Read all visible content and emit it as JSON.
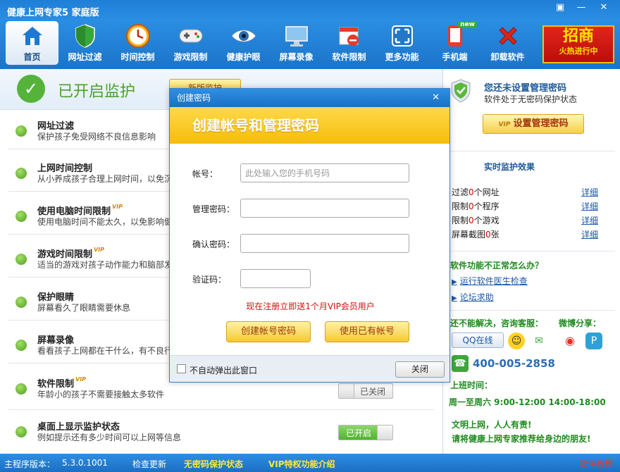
{
  "app": {
    "title": "健康上网专家5 家庭版",
    "window_buttons": [
      "▣",
      "—",
      "✕"
    ]
  },
  "toolbar": {
    "items": [
      {
        "label": "首页",
        "icon": "home-icon",
        "active": true
      },
      {
        "label": "网址过滤",
        "icon": "shield-icon"
      },
      {
        "label": "时间控制",
        "icon": "clock-icon"
      },
      {
        "label": "游戏限制",
        "icon": "gamepad-icon"
      },
      {
        "label": "健康护眼",
        "icon": "eye-icon"
      },
      {
        "label": "屏幕录像",
        "icon": "monitor-icon"
      },
      {
        "label": "软件限制",
        "icon": "software-block-icon"
      },
      {
        "label": "更多功能",
        "icon": "expand-icon"
      },
      {
        "label": "手机端",
        "icon": "phone-icon",
        "badge": "new"
      },
      {
        "label": "卸载软件",
        "icon": "uninstall-icon"
      }
    ],
    "promo": {
      "big": "招商",
      "small": "火热进行中"
    }
  },
  "status": {
    "text": "已开启监护",
    "renew_label": "新版监护"
  },
  "features": [
    {
      "title": "网址过滤",
      "vip": false,
      "desc": "保护孩子免受网络不良信息影响"
    },
    {
      "title": "上网时间控制",
      "vip": false,
      "desc": "从小养成孩子合理上网时间，以免沉"
    },
    {
      "title": "使用电脑时间限制",
      "vip": true,
      "desc": "使用电脑时间不能太久，以免影响健"
    },
    {
      "title": "游戏时间限制",
      "vip": true,
      "desc": "适当的游戏对孩子动作能力和脑部发"
    },
    {
      "title": "保护眼睛",
      "vip": false,
      "desc": "屏幕看久了眼睛需要休息"
    },
    {
      "title": "屏幕录像",
      "vip": false,
      "desc": "看看孩子上网都在干什么，有不良行"
    },
    {
      "title": "软件限制",
      "vip": true,
      "desc": "年龄小的孩子不需要接触太多软件",
      "toggle": "已关闭"
    },
    {
      "title": "桌面上显示监护状态",
      "vip": false,
      "desc": "例如提示还有多少时间可以上网等信息",
      "toggle": "已开启"
    }
  ],
  "vip_tag": "VIP",
  "right": {
    "title": "您还未设置管理密码",
    "subtitle": "软件处于无密码保护状态",
    "set_pwd_label": "设置管理密码",
    "monitor_title": "实时监护效果",
    "stats": [
      {
        "pre": "过滤",
        "num": "0",
        "post": "个网址",
        "link": "详细"
      },
      {
        "pre": "限制",
        "num": "0",
        "post": "个程序",
        "link": "详细"
      },
      {
        "pre": "限制",
        "num": "0",
        "post": "个游戏",
        "link": "详细"
      },
      {
        "pre": "屏幕截图",
        "num": "0",
        "post": "张",
        "link": "详细"
      }
    ],
    "q_title": "软件功能不正常怎么办？",
    "links": [
      "运行软件医生检查",
      "论坛求助"
    ],
    "consult": "还不能解决，咨询客服：",
    "weibo": "微博分享：",
    "qq_label": "QQ在线",
    "phone": "400-005-2858",
    "worktime_label": "上班时间：",
    "worktime": "周一至周六 9:00-12:00 14:00-18:00",
    "slogan1": "文明上网，人人有责!",
    "slogan2": "请将健康上网专家推荐给身边的朋友!"
  },
  "statusbar": {
    "version_label": "主程序版本：",
    "version": "5.3.0.1001",
    "check_update": "检查更新",
    "no_pwd": "无密码保护状态",
    "vip_intro": "VIP特权功能介绍",
    "tutorial": "软件教程"
  },
  "modal": {
    "title": "创建密码",
    "close_x": "✕",
    "banner": "创建帐号和管理密码",
    "account_label": "帐号：",
    "account_placeholder": "此处输入您的手机号码",
    "password_label": "管理密码：",
    "confirm_label": "确认密码：",
    "captcha_label": "验证码：",
    "promo": "现在注册立即送1个月VIP会员用户",
    "create_btn": "创建帐号密码",
    "use_existing_btn": "使用已有帐号",
    "no_popup_label": "不自动弹出此窗口",
    "close_btn": "关闭"
  }
}
